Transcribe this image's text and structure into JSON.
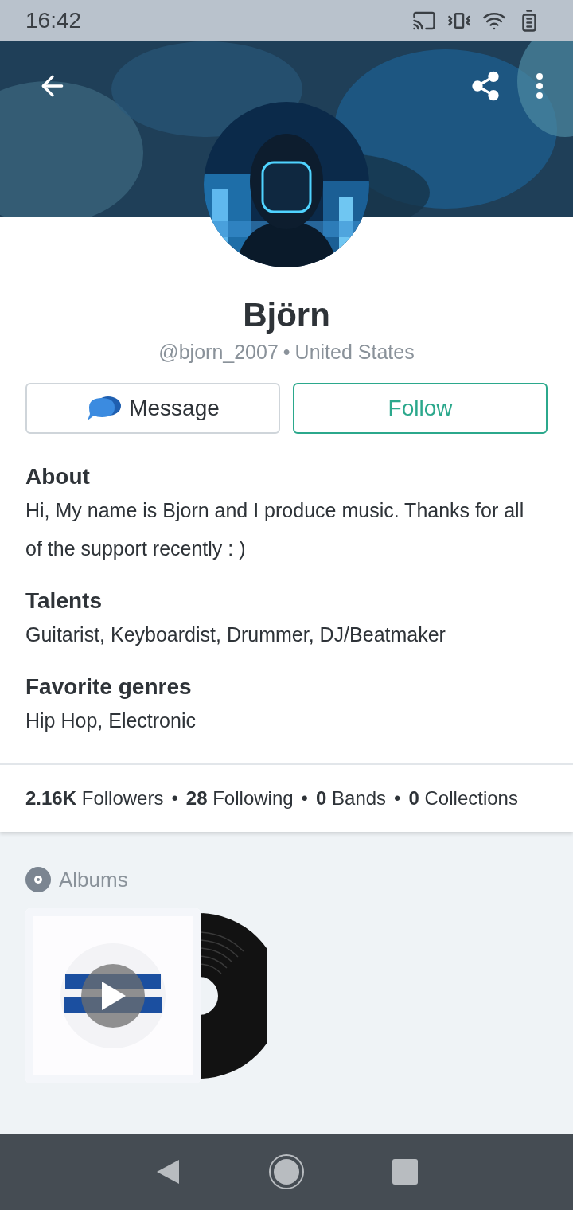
{
  "status_bar": {
    "time": "16:42"
  },
  "profile": {
    "name": "Björn",
    "handle": "@bjorn_2007",
    "separator": "•",
    "location": "United States"
  },
  "actions": [
    {
      "kind": "message",
      "label": "Message"
    },
    {
      "kind": "follow",
      "label": "Follow"
    }
  ],
  "sections": [
    {
      "title": "About",
      "text": "Hi, My name is Bjorn and I produce music. Thanks for all of the support recently : )"
    },
    {
      "title": "Talents",
      "text": "Guitarist, Keyboardist, Drummer, DJ/Beatmaker"
    },
    {
      "title": "Favorite genres",
      "text": "Hip Hop, Electronic"
    }
  ],
  "stats": [
    {
      "count": "2.16K",
      "label": "Followers"
    },
    {
      "count": "28",
      "label": "Following"
    },
    {
      "count": "0",
      "label": "Bands"
    },
    {
      "count": "0",
      "label": "Collections"
    }
  ],
  "stats_separator": "•",
  "albums": {
    "title": "Albums"
  }
}
